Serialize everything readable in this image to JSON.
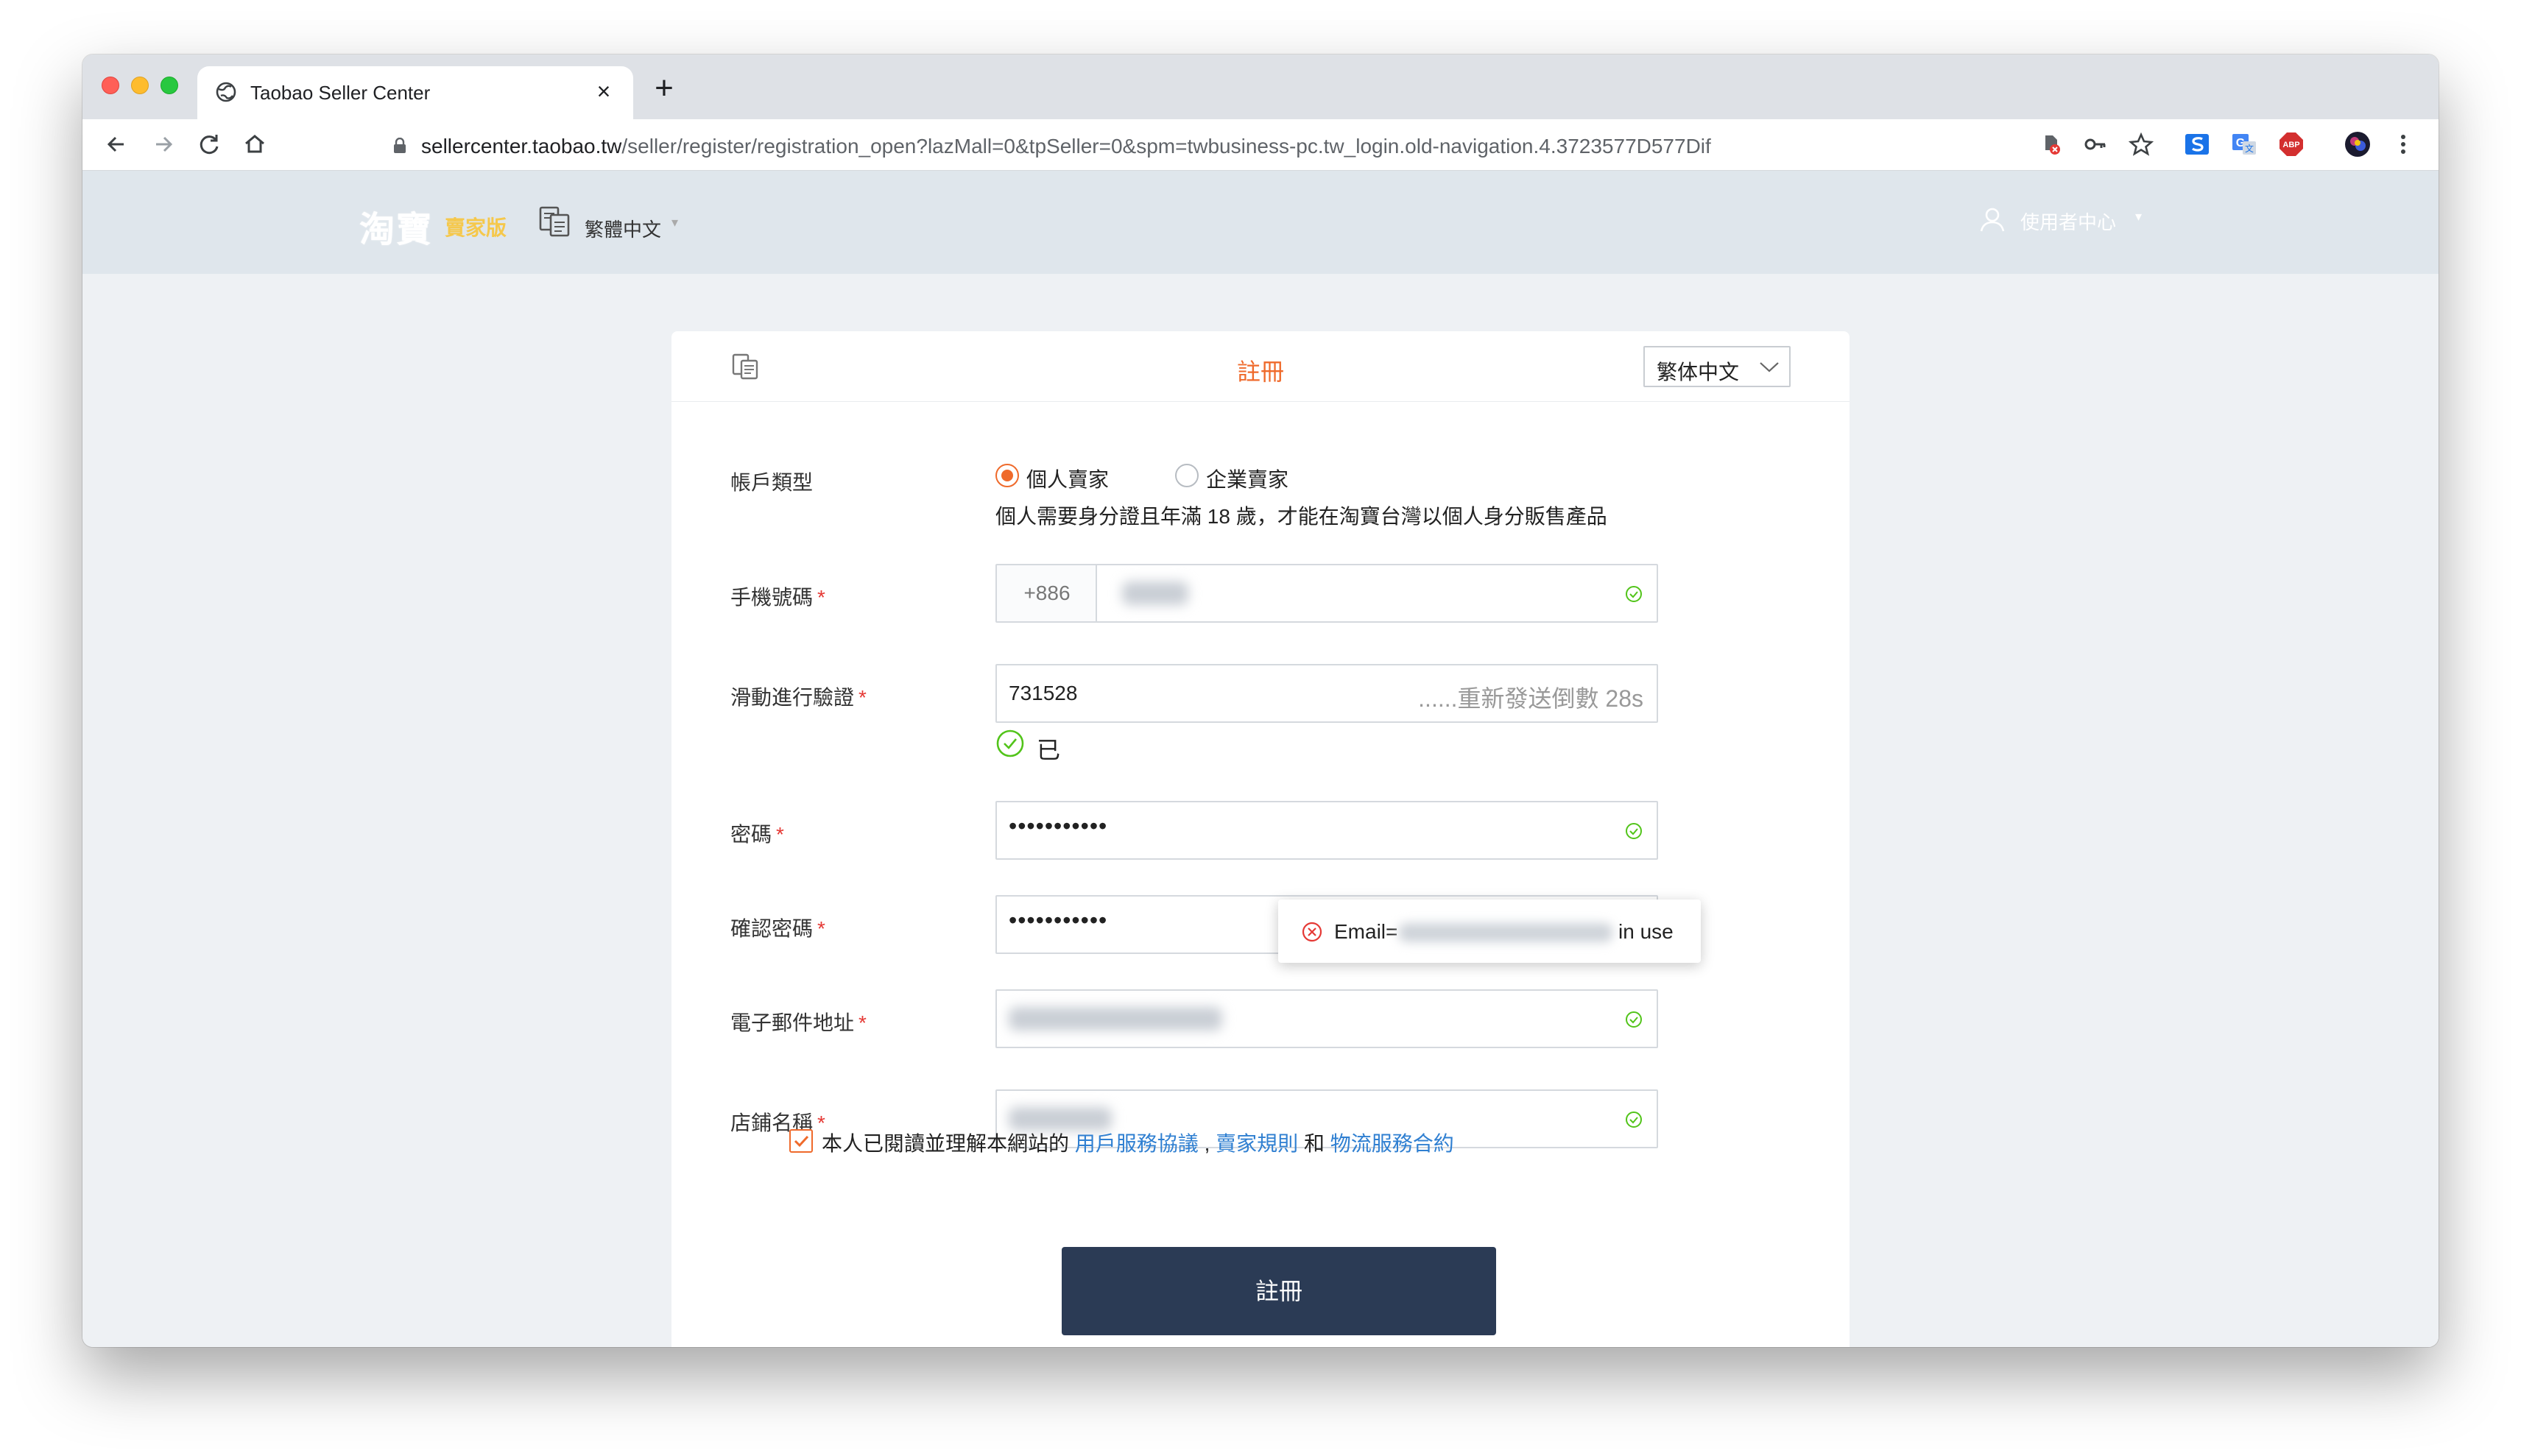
{
  "browser": {
    "tab_title": "Taobao Seller Center",
    "tab_close": "×",
    "new_tab": "+",
    "url_host": "sellercenter.taobao.tw",
    "url_path": "/seller/register/registration_open?lazMall=0&tpSeller=0&spm=twbusiness-pc.tw_login.old-navigation.4.3723577D577Dif",
    "extensions": [
      "shield-off-icon",
      "key-icon",
      "star-icon",
      "s-extension-icon",
      "translate-icon",
      "adblock-icon",
      "profile-avatar-icon",
      "more-icon"
    ],
    "abp_label": "ABP"
  },
  "header": {
    "logo_main": "淘寶",
    "logo_sub": "賣家版",
    "language": "繁體中文",
    "user_center": "使用者中心",
    "caret": "▾"
  },
  "card": {
    "title": "註冊",
    "language_select": "繁体中文",
    "account_type": {
      "label": "帳戶類型",
      "options": [
        "個人賣家",
        "企業賣家"
      ],
      "selected": "個人賣家",
      "hint": "個人需要身分證且年滿 18 歲，才能在淘寶台灣以個人身分販售產品"
    },
    "phone": {
      "label": "手機號碼",
      "required": "*",
      "prefix": "+886"
    },
    "verification": {
      "label": "滑動進行驗證",
      "required": "*",
      "value": "731528",
      "countdown": "......重新發送倒數 28s",
      "verified_text": "已"
    },
    "password": {
      "label": "密碼",
      "required": "*",
      "value": "•••••••••••"
    },
    "confirm_password": {
      "label": "確認密碼",
      "required": "*",
      "value": "•••••••••••"
    },
    "email": {
      "label": "電子郵件地址",
      "required": "*"
    },
    "shop_name": {
      "label": "店鋪名稱",
      "required": "*"
    },
    "tooltip": {
      "prefix": "Email=",
      "suffix": "in use"
    },
    "agreement": {
      "checked": true,
      "text": "本人已閱讀並理解本網站的",
      "link1": "用戶服務協議",
      "sep": ",",
      "link2": "賣家規則",
      "and": "和",
      "link3": "物流服務合約"
    },
    "submit": "註冊"
  },
  "colors": {
    "accent": "#ef6a2b",
    "primary_button": "#2b3b55",
    "link": "#2f7fd1",
    "valid": "#52c41a",
    "error": "#e53935"
  }
}
